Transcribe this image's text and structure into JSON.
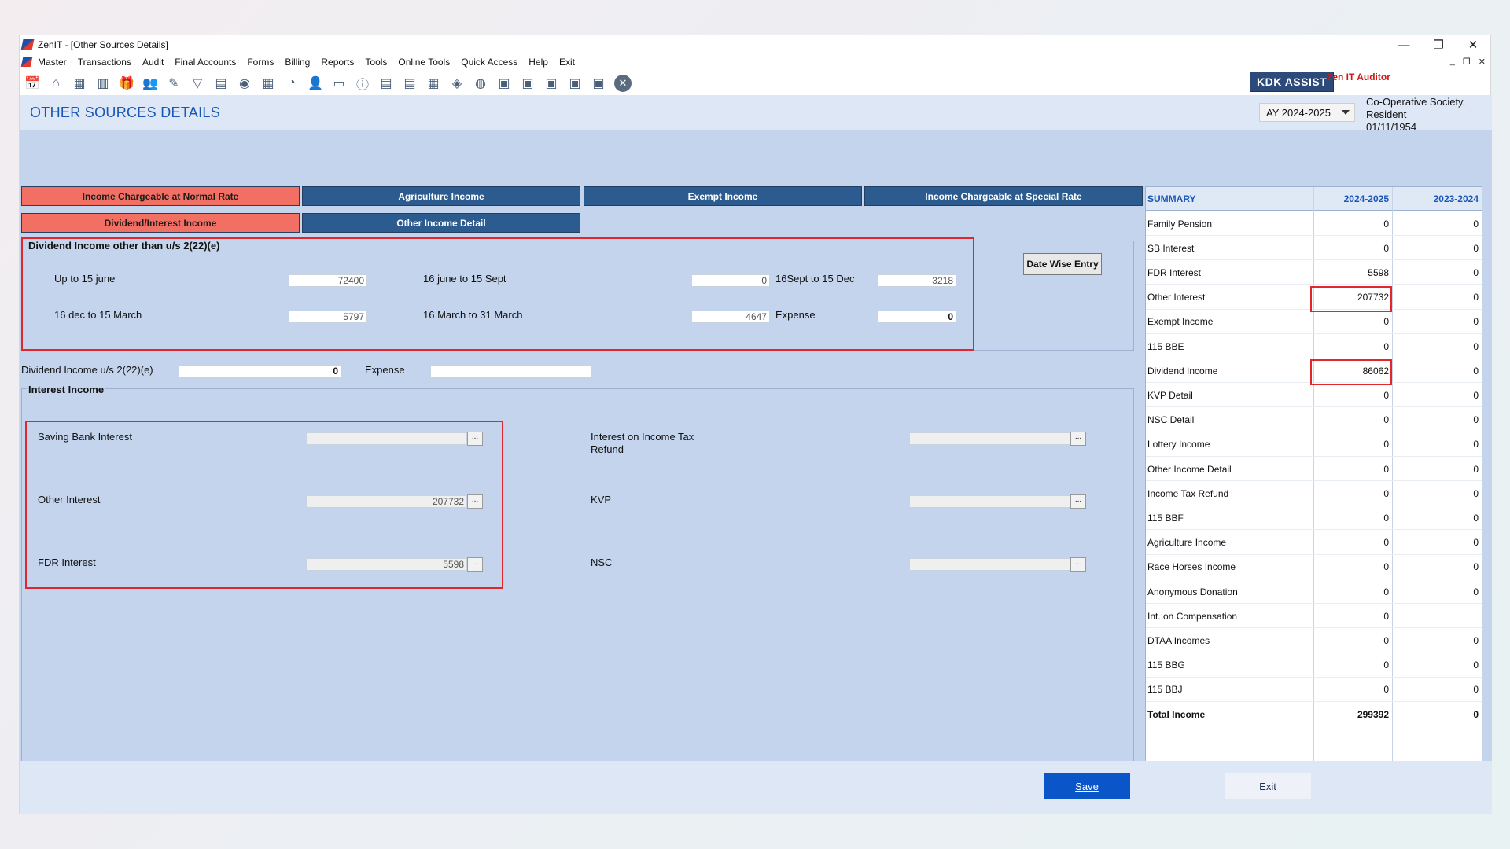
{
  "window": {
    "title": "ZenIT - [Other Sources Details]",
    "controls": {
      "minimize": "—",
      "restore": "❐",
      "close": "✕"
    }
  },
  "menu": [
    "Master",
    "Transactions",
    "Audit",
    "Final Accounts",
    "Forms",
    "Billing",
    "Reports",
    "Tools",
    "Online Tools",
    "Quick Access",
    "Help",
    "Exit"
  ],
  "mdi_controls": [
    "_",
    "❐",
    "✕"
  ],
  "toolbar_icons": [
    "📅",
    "⌂",
    "▦",
    "▥",
    "🎁",
    "👥",
    "✎",
    "▽",
    "▤",
    "◉",
    "▦",
    "◔",
    "👤",
    "▭",
    "ⓘ",
    "▤",
    "▤",
    "▦",
    "◈",
    "◍",
    "▣",
    "▣",
    "▣",
    "▣",
    "▣"
  ],
  "brand": {
    "kdk_assist": "KDK ASSIST",
    "zen_it_auditor": "Zen IT Auditor"
  },
  "page_title": "OTHER SOURCES DETAILS",
  "assessment_year": "AY 2024-2025",
  "client": {
    "line1": "Co-Operative Society,",
    "line2": "Resident",
    "line3": "01/11/1954"
  },
  "tabs": {
    "row1": [
      {
        "label": "Income Chargeable at Normal Rate",
        "active": true
      },
      {
        "label": "Agriculture Income",
        "active": false
      },
      {
        "label": "Exempt Income",
        "active": false
      },
      {
        "label": "Income Chargeable at Special Rate",
        "active": false
      }
    ],
    "row2": [
      {
        "label": "Dividend/Interest Income",
        "active": true
      },
      {
        "label": "Other Income Detail",
        "active": false
      }
    ]
  },
  "dividend_other": {
    "title": "Dividend Income other than u/s 2(22)(e)",
    "up_to_15_june": {
      "label": "Up to 15 june",
      "value": "72400"
    },
    "june_to_sept": {
      "label": "16 june to 15 Sept",
      "value": "0"
    },
    "sept_to_dec": {
      "label": "16Sept to 15 Dec",
      "value": "3218"
    },
    "dec_to_march": {
      "label": "16 dec to 15 March",
      "value": "5797"
    },
    "march_to_31": {
      "label": "16 March to 31 March",
      "value": "4647"
    },
    "expense": {
      "label": "Expense",
      "value": "0"
    },
    "date_wise_entry": "Date Wise Entry"
  },
  "dividend_2222e": {
    "label": "Dividend Income  u/s 2(22)(e)",
    "value": "0",
    "expense_label": "Expense",
    "expense_value": ""
  },
  "interest_income": {
    "title": "Interest Income",
    "saving_bank": {
      "label": "Saving Bank Interest",
      "value": ""
    },
    "other_interest": {
      "label": "Other Interest",
      "value": "207732"
    },
    "fdr_interest": {
      "label": "FDR Interest",
      "value": "5598"
    },
    "it_refund": {
      "label_line1": "Interest on Income Tax",
      "label_line2": "Refund",
      "value": ""
    },
    "kvp": {
      "label": "KVP",
      "value": ""
    },
    "nsc": {
      "label": "NSC",
      "value": ""
    },
    "dots": "..."
  },
  "summary": {
    "headers": [
      "SUMMARY",
      "2024-2025",
      "2023-2024"
    ],
    "rows": [
      {
        "label": "Family Pension",
        "cur": "0",
        "prev": "0"
      },
      {
        "label": "SB Interest",
        "cur": "0",
        "prev": "0"
      },
      {
        "label": "FDR Interest",
        "cur": "5598",
        "prev": "0"
      },
      {
        "label": "Other Interest",
        "cur": "207732",
        "prev": "0"
      },
      {
        "label": "Exempt Income",
        "cur": "0",
        "prev": "0"
      },
      {
        "label": "115 BBE",
        "cur": "0",
        "prev": "0"
      },
      {
        "label": "Dividend Income",
        "cur": "86062",
        "prev": "0"
      },
      {
        "label": "KVP Detail",
        "cur": "0",
        "prev": "0"
      },
      {
        "label": "NSC Detail",
        "cur": "0",
        "prev": "0"
      },
      {
        "label": "Lottery Income",
        "cur": "0",
        "prev": "0"
      },
      {
        "label": "Other Income Detail",
        "cur": "0",
        "prev": "0"
      },
      {
        "label": "Income Tax Refund",
        "cur": "0",
        "prev": "0"
      },
      {
        "label": "115 BBF",
        "cur": "0",
        "prev": "0"
      },
      {
        "label": "Agriculture Income",
        "cur": "0",
        "prev": "0"
      },
      {
        "label": "Race Horses Income",
        "cur": "0",
        "prev": "0"
      },
      {
        "label": "Anonymous Donation",
        "cur": "0",
        "prev": "0"
      },
      {
        "label": "Int. on Compensation",
        "cur": "0",
        "prev": ""
      },
      {
        "label": "DTAA Incomes",
        "cur": "0",
        "prev": "0"
      },
      {
        "label": "115 BBG",
        "cur": "0",
        "prev": "0"
      },
      {
        "label": "115 BBJ",
        "cur": "0",
        "prev": "0"
      },
      {
        "label": "Total Income",
        "cur": "299392",
        "prev": "0"
      }
    ]
  },
  "buttons": {
    "save": "Save",
    "exit": "Exit"
  },
  "colors": {
    "active_tab": "#f26f64",
    "inactive_tab": "#2c5c8f",
    "highlight": "#e2262e",
    "panel": "#c3d4ec",
    "save": "#0a55c8"
  }
}
